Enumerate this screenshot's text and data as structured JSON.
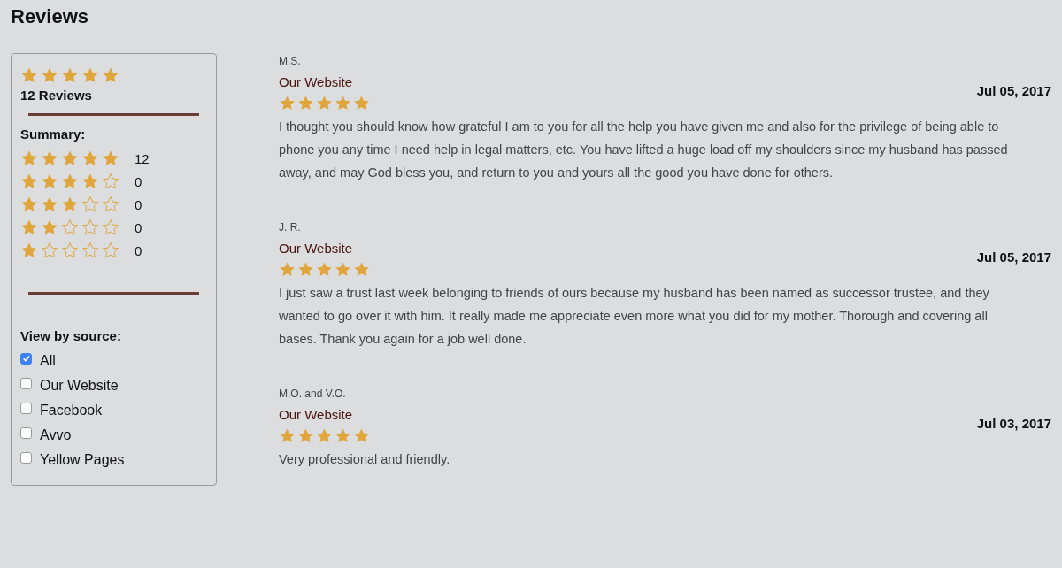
{
  "page_title": "Reviews",
  "summary_panel": {
    "stars": 5,
    "review_count": "12 Reviews",
    "summary_label": "Summary:",
    "breakdown": [
      {
        "stars": 5,
        "count": "12"
      },
      {
        "stars": 4,
        "count": "0"
      },
      {
        "stars": 3,
        "count": "0"
      },
      {
        "stars": 2,
        "count": "0"
      },
      {
        "stars": 1,
        "count": "0"
      }
    ],
    "source_label": "View by source:",
    "sources": [
      {
        "label": "All",
        "checked": true
      },
      {
        "label": "Our Website",
        "checked": false
      },
      {
        "label": "Facebook",
        "checked": false
      },
      {
        "label": "Avvo",
        "checked": false
      },
      {
        "label": "Yellow Pages",
        "checked": false
      }
    ]
  },
  "reviews": [
    {
      "author": "M.S.",
      "source": "Our Website",
      "date": "Jul 05, 2017",
      "stars": 5,
      "text": "I thought you should know how grateful I am to you for all the help you have given me and also for the privilege of being able to phone you any time I need help in legal matters, etc. You have lifted a huge load off my shoulders since my husband has passed away, and may God bless you, and return to you and yours all the good you have done for others."
    },
    {
      "author": "J. R.",
      "source": "Our Website",
      "date": "Jul 05, 2017",
      "stars": 5,
      "text": "I just saw a trust last week belonging to friends of ours because my husband has been named as successor trustee, and they wanted to go over it with him. It really made me appreciate even more what you did for my mother. Thorough and covering all bases. Thank you again for a job well done."
    },
    {
      "author": "M.O. and V.O.",
      "source": "Our Website",
      "date": "Jul 03, 2017",
      "stars": 5,
      "text": "Very professional and friendly."
    }
  ]
}
